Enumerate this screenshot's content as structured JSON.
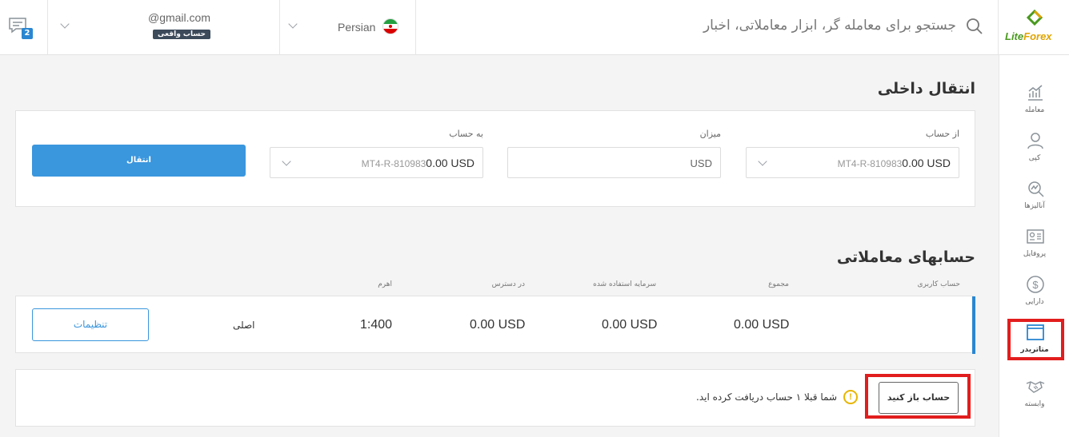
{
  "header": {
    "messages_badge": "2",
    "account": {
      "email": "@gmail.com",
      "type_label": "حساب واقعی"
    },
    "language": {
      "label": "Persian"
    },
    "search": {
      "placeholder": "جستجو برای معامله گر، ابزار معاملاتی، اخبار"
    },
    "logo": {
      "text_main": "Lite",
      "text_fx": "Forex"
    }
  },
  "sidebar": {
    "items": [
      {
        "label": "معامله",
        "icon": "chart-icon"
      },
      {
        "label": "کپی",
        "icon": "copy-person-icon"
      },
      {
        "label": "آنالیزها",
        "icon": "analysis-icon"
      },
      {
        "label": "پروفایل",
        "icon": "profile-card-icon"
      },
      {
        "label": "دارایی",
        "icon": "dollar-icon"
      },
      {
        "label": "متاتریدر",
        "icon": "window-icon",
        "active": true
      },
      {
        "label": "وابسته",
        "icon": "handshake-icon"
      }
    ]
  },
  "transfer": {
    "title": "انتقال داخلی",
    "from_label": "از حساب",
    "from_account": "MT4-R-810983",
    "from_amount": "0.00 USD",
    "amount_label": "میزان",
    "amount_placeholder": "USD",
    "to_label": "به حساب",
    "to_account": "MT4-R-810983",
    "to_amount": "0.00 USD",
    "submit_label": "انتقال"
  },
  "accounts": {
    "title": "حسابهای معاملاتی",
    "columns": [
      "حساب کاربری",
      "مجموع",
      "سرمایه استفاده شده",
      "در دسترس",
      "اهرم"
    ],
    "row": {
      "total": "0.00 USD",
      "used": "0.00 USD",
      "available": "0.00 USD",
      "leverage": "1:400",
      "type": "اصلی",
      "settings_label": "تنظیمات"
    }
  },
  "notice": {
    "open_button": "حساب باز کنید",
    "warning_symbol": "!",
    "text": "شما قبلا ۱ حساب دریافت کرده اید."
  },
  "colors": {
    "accent": "#3a96dd",
    "highlight": "#e21d1d",
    "warning": "#e8b500"
  }
}
